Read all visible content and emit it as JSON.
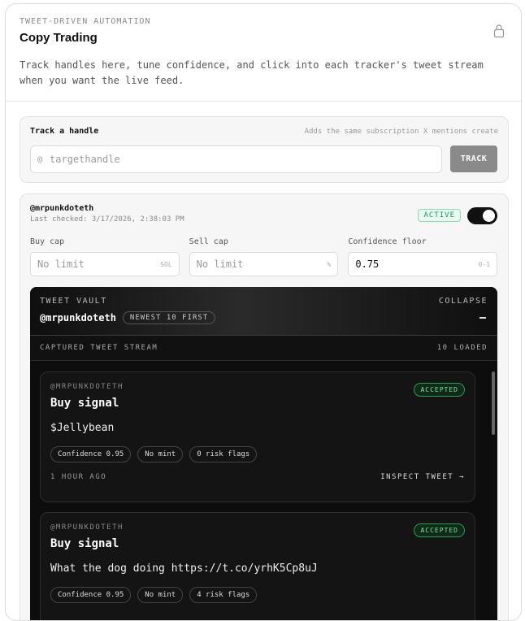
{
  "header": {
    "eyebrow": "TWEET-DRIVEN AUTOMATION",
    "title": "Copy Trading",
    "description": "Track handles here, tune confidence, and click into each tracker's tweet stream when you want the live feed.",
    "lock_icon": "lock-icon"
  },
  "track": {
    "label": "Track a handle",
    "hint": "Adds the same subscription X mentions create",
    "at": "@",
    "placeholder": "targethandle",
    "button": "TRACK"
  },
  "tracker": {
    "handle": "@mrpunkdoteth",
    "last_checked": "Last checked: 3/17/2026, 2:38:03 PM",
    "status": "ACTIVE",
    "enabled": true,
    "fields": [
      {
        "label": "Buy cap",
        "value": "",
        "placeholder": "No limit",
        "unit": "SOL"
      },
      {
        "label": "Sell cap",
        "value": "",
        "placeholder": "No limit",
        "unit": "%"
      },
      {
        "label": "Confidence floor",
        "value": "0.75",
        "placeholder": "",
        "unit": "0-1"
      }
    ]
  },
  "vault": {
    "eyebrow": "TWEET VAULT",
    "collapse": "COLLAPSE",
    "handle": "@mrpunkdoteth",
    "order": "NEWEST 10 FIRST",
    "stream_label": "CAPTURED TWEET STREAM",
    "loaded": "10 LOADED",
    "tweets": [
      {
        "user": "@MRPUNKDOTETH",
        "title": "Buy signal",
        "body": "$Jellybean",
        "status": "ACCEPTED",
        "pills": [
          "Confidence 0.95",
          "No mint",
          "0 risk flags"
        ],
        "time": "1 HOUR AGO",
        "inspect": "INSPECT TWEET →"
      },
      {
        "user": "@MRPUNKDOTETH",
        "title": "Buy signal",
        "body": "What the dog doing https://t.co/yrhK5Cp8uJ",
        "status": "ACCEPTED",
        "pills": [
          "Confidence 0.95",
          "No mint",
          "4 risk flags"
        ],
        "time": "",
        "inspect": ""
      }
    ]
  }
}
